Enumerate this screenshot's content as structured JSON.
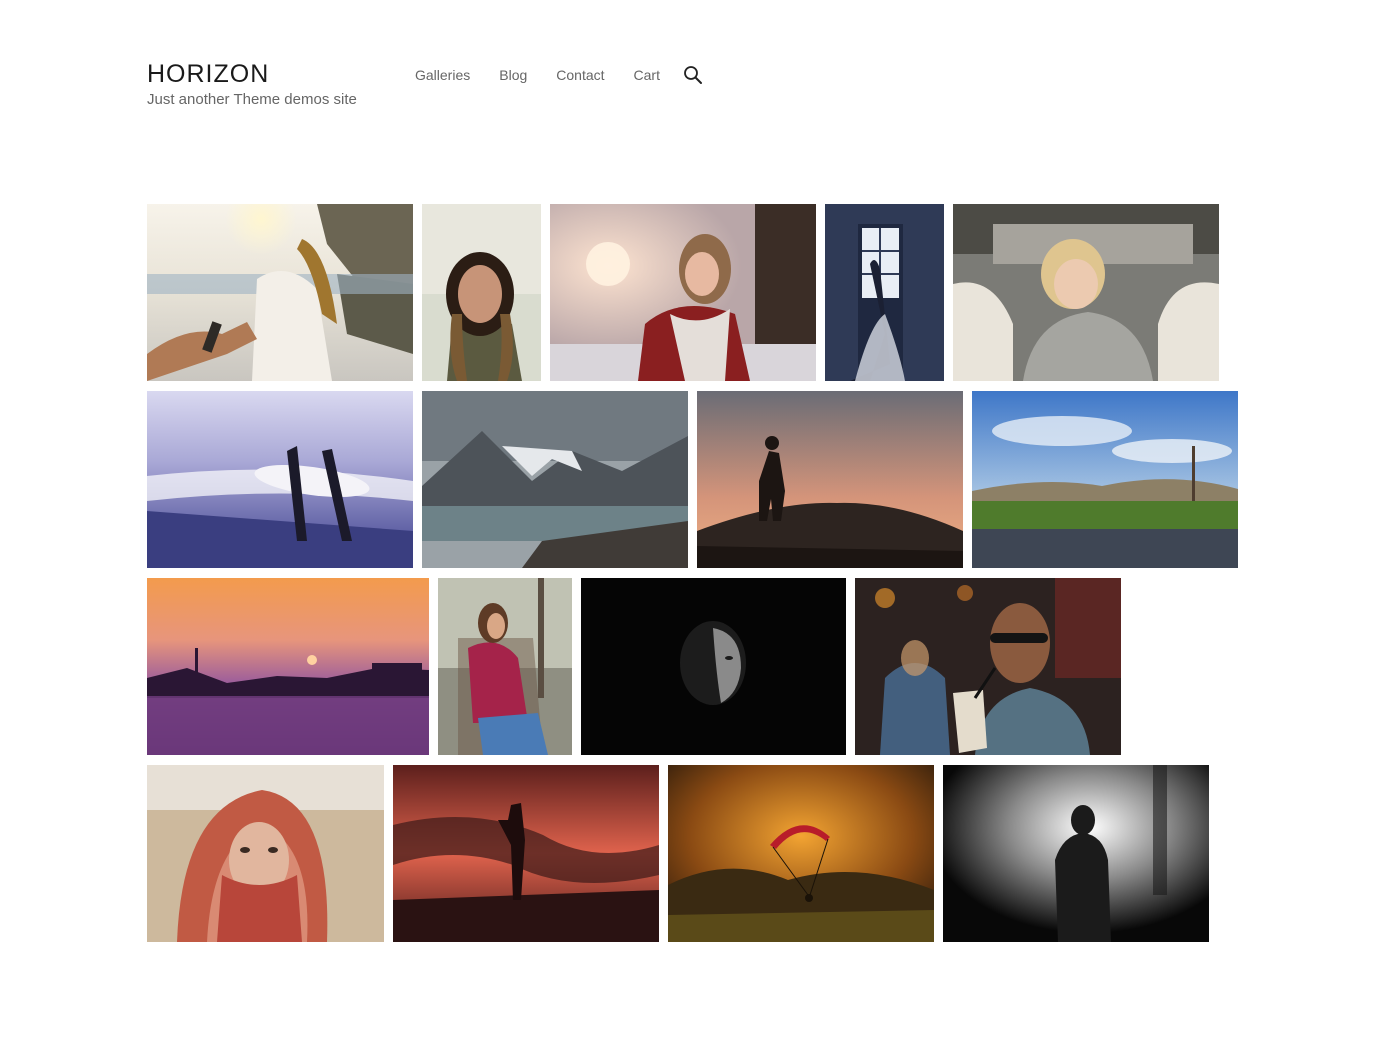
{
  "site": {
    "title": "HORIZON",
    "description": "Just another Theme demos site"
  },
  "nav": {
    "items": [
      {
        "label": "Galleries"
      },
      {
        "label": "Blog"
      },
      {
        "label": "Contact"
      },
      {
        "label": "Cart"
      }
    ],
    "search_icon": "search-icon"
  },
  "gallery": {
    "rows": [
      [
        {
          "subject": "beach-hand-hold-photo"
        },
        {
          "subject": "woman-portrait-photo"
        },
        {
          "subject": "woman-winter-scarf-photo"
        },
        {
          "subject": "bride-window-photo"
        },
        {
          "subject": "blonde-woman-smiling-photo"
        }
      ],
      [
        {
          "subject": "surfers-beach-photo"
        },
        {
          "subject": "mountain-lake-photo"
        },
        {
          "subject": "hiker-silhouette-photo"
        },
        {
          "subject": "vineyard-road-photo"
        }
      ],
      [
        {
          "subject": "purple-sunset-harbor-photo"
        },
        {
          "subject": "woman-red-sweater-photo"
        },
        {
          "subject": "dark-face-portrait-photo"
        },
        {
          "subject": "man-sunglasses-drink-photo"
        }
      ],
      [
        {
          "subject": "woman-headscarf-photo"
        },
        {
          "subject": "red-sky-silhouette-photo"
        },
        {
          "subject": "paraglider-photo"
        },
        {
          "subject": "foggy-figure-photo"
        }
      ]
    ]
  },
  "colors": {
    "title": "#1a1a1a",
    "nav_text": "#666666",
    "background": "#ffffff"
  }
}
